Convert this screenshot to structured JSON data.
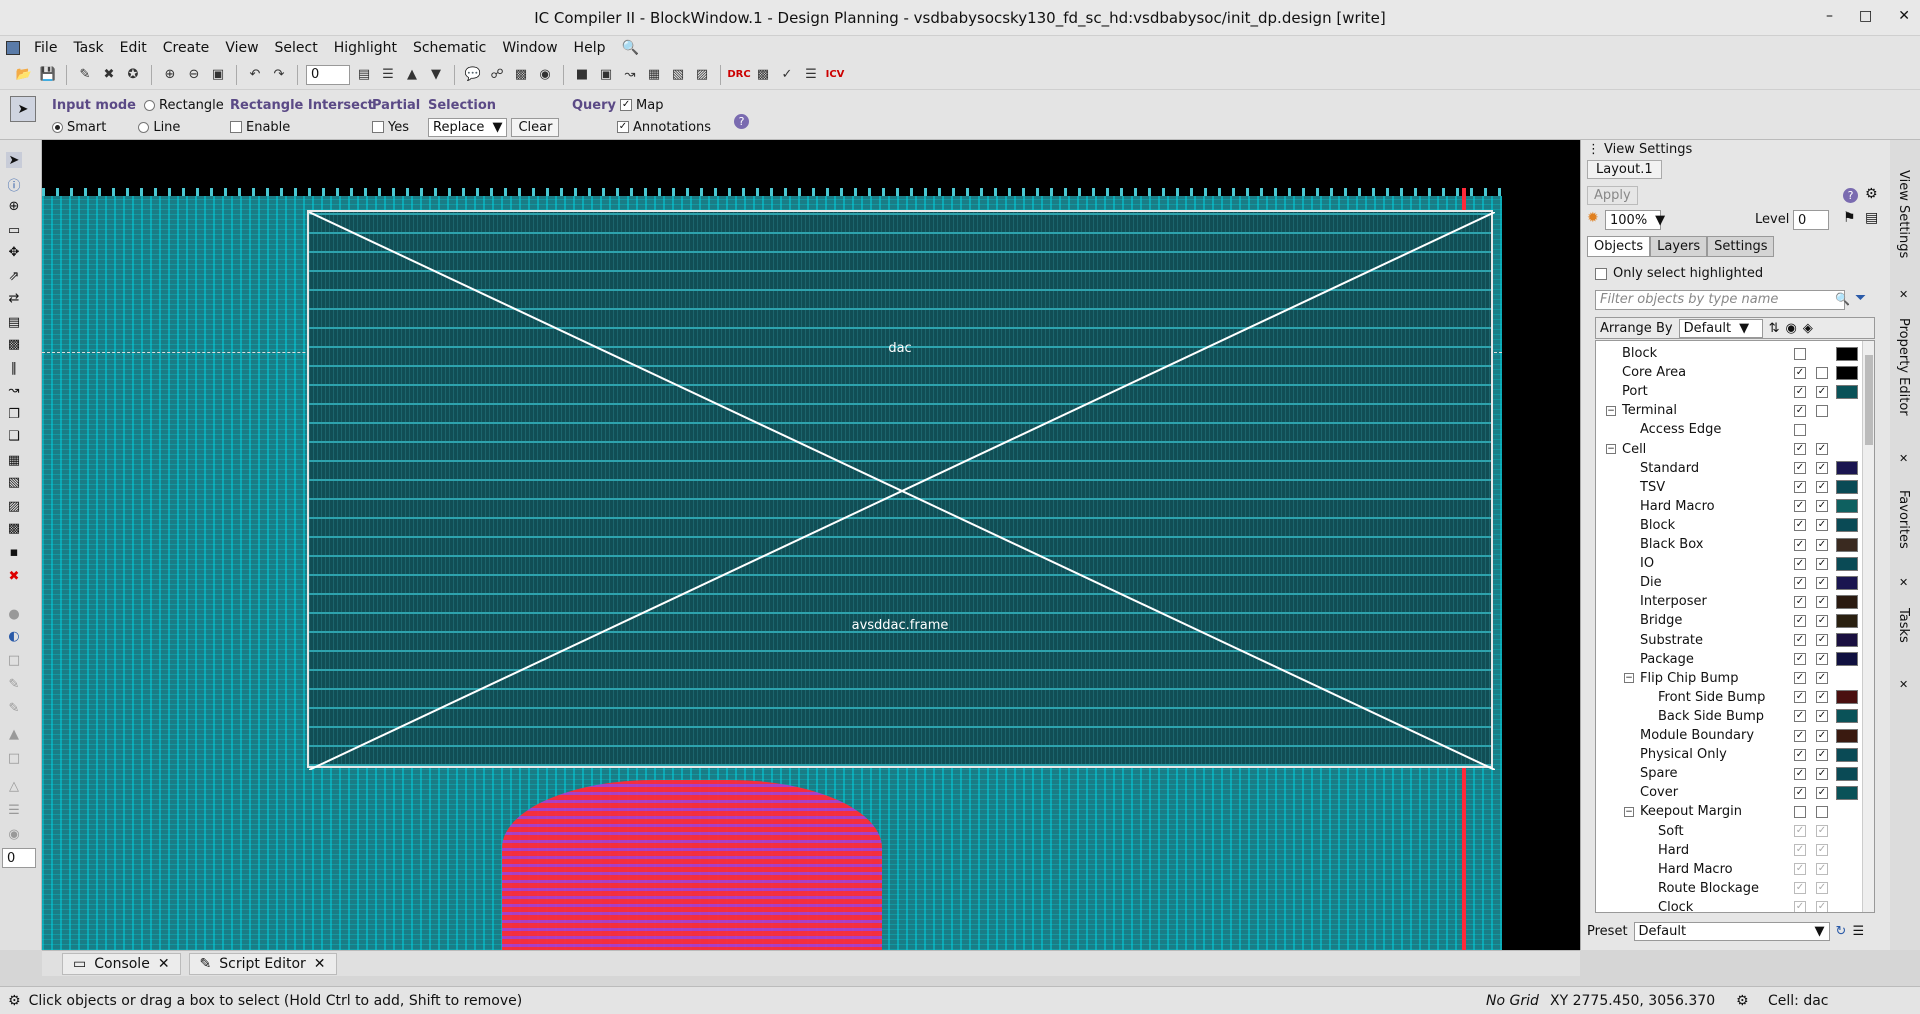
{
  "window": {
    "title": "IC Compiler II - BlockWindow.1 - Design Planning - vsdbabysocsky130_fd_sc_hd:vsdbabysoc/init_dp.design [write]"
  },
  "menu": [
    "File",
    "Task",
    "Edit",
    "Create",
    "View",
    "Select",
    "Highlight",
    "Schematic",
    "Window",
    "Help"
  ],
  "toolbar": {
    "level_value": "0"
  },
  "options": {
    "input_mode": {
      "label": "Input mode",
      "opt1": "Rectangle",
      "opt2": "Smart",
      "opt3": "Line",
      "selected": "Smart"
    },
    "rect_intersect": {
      "label": "Rectangle Intersect",
      "enable": "Enable"
    },
    "partial": {
      "label": "Partial",
      "yes": "Yes"
    },
    "selection": {
      "label": "Selection",
      "value": "Replace",
      "clear": "Clear"
    },
    "query": {
      "label": "Query",
      "map": "Map",
      "annotations": "Annotations"
    }
  },
  "canvas": {
    "cell_label": "dac",
    "frame_label": "avsddac.frame",
    "left_zoom_value": "0"
  },
  "bottom_tabs": {
    "console": "Console",
    "script_editor": "Script Editor"
  },
  "status": {
    "hint": "Click objects or drag a box to select (Hold Ctrl to add, Shift to remove)",
    "grid": "No Grid",
    "xy": "XY 2775.450, 3056.370",
    "cell": "Cell: dac"
  },
  "view_settings": {
    "title": "View Settings",
    "layout_tab": "Layout.1",
    "apply": "Apply",
    "zoom": "100%",
    "level_label": "Level",
    "level_value": "0",
    "tabs": [
      "Objects",
      "Layers",
      "Settings"
    ],
    "only_select_highlighted": "Only select highlighted",
    "filter_placeholder": "Filter objects by type name",
    "arrange_by": "Arrange By",
    "arrange_value": "Default",
    "preset_label": "Preset",
    "preset_value": "Default",
    "objects": [
      {
        "name": "Block",
        "indent": 0,
        "exp": "",
        "c1": "off",
        "c2": "",
        "color": "#000000"
      },
      {
        "name": "Core Area",
        "indent": 0,
        "exp": "",
        "c1": "on",
        "c2": "off",
        "color": "#000000"
      },
      {
        "name": "Port",
        "indent": 0,
        "exp": "",
        "c1": "on",
        "c2": "on",
        "color": "#0a5258"
      },
      {
        "name": "Terminal",
        "indent": 0,
        "exp": "-",
        "c1": "on",
        "c2": "off",
        "color": ""
      },
      {
        "name": "Access Edge",
        "indent": 1,
        "exp": "",
        "c1": "off",
        "c2": "",
        "color": ""
      },
      {
        "name": "Cell",
        "indent": 0,
        "exp": "-",
        "c1": "on",
        "c2": "on",
        "color": ""
      },
      {
        "name": "Standard",
        "indent": 1,
        "exp": "",
        "c1": "on",
        "c2": "on",
        "color": "#1a1550"
      },
      {
        "name": "TSV",
        "indent": 1,
        "exp": "",
        "c1": "on",
        "c2": "on",
        "color": "#0a4a55"
      },
      {
        "name": "Hard Macro",
        "indent": 1,
        "exp": "",
        "c1": "on",
        "c2": "on",
        "color": "#0e6060"
      },
      {
        "name": "Block",
        "indent": 1,
        "exp": "",
        "c1": "on",
        "c2": "on",
        "color": "#0a4a55"
      },
      {
        "name": "Black Box",
        "indent": 1,
        "exp": "",
        "c1": "on",
        "c2": "on",
        "color": "#3a2a20"
      },
      {
        "name": "IO",
        "indent": 1,
        "exp": "",
        "c1": "on",
        "c2": "on",
        "color": "#0a4a55"
      },
      {
        "name": "Die",
        "indent": 1,
        "exp": "",
        "c1": "on",
        "c2": "on",
        "color": "#1a1550"
      },
      {
        "name": "Interposer",
        "indent": 1,
        "exp": "",
        "c1": "on",
        "c2": "on",
        "color": "#2a1a10"
      },
      {
        "name": "Bridge",
        "indent": 1,
        "exp": "",
        "c1": "on",
        "c2": "on",
        "color": "#2a2010"
      },
      {
        "name": "Substrate",
        "indent": 1,
        "exp": "",
        "c1": "on",
        "c2": "on",
        "color": "#1a1040"
      },
      {
        "name": "Package",
        "indent": 1,
        "exp": "",
        "c1": "on",
        "c2": "on",
        "color": "#101040"
      },
      {
        "name": "Flip Chip Bump",
        "indent": 1,
        "exp": "-",
        "c1": "on",
        "c2": "on",
        "color": ""
      },
      {
        "name": "Front Side Bump",
        "indent": 2,
        "exp": "",
        "c1": "on",
        "c2": "on",
        "color": "#4a1010"
      },
      {
        "name": "Back Side Bump",
        "indent": 2,
        "exp": "",
        "c1": "on",
        "c2": "on",
        "color": "#0a5258"
      },
      {
        "name": "Module Boundary",
        "indent": 1,
        "exp": "",
        "c1": "on",
        "c2": "on",
        "color": "#3a1a10"
      },
      {
        "name": "Physical Only",
        "indent": 1,
        "exp": "",
        "c1": "on",
        "c2": "on",
        "color": "#0a4a55"
      },
      {
        "name": "Spare",
        "indent": 1,
        "exp": "",
        "c1": "on",
        "c2": "on",
        "color": "#0a4a55"
      },
      {
        "name": "Cover",
        "indent": 1,
        "exp": "",
        "c1": "on",
        "c2": "on",
        "color": "#0a5258"
      },
      {
        "name": "Keepout Margin",
        "indent": 1,
        "exp": "-",
        "c1": "off",
        "c2": "off",
        "color": ""
      },
      {
        "name": "Soft",
        "indent": 2,
        "exp": "",
        "c1": "dim",
        "c2": "dim",
        "color": ""
      },
      {
        "name": "Hard",
        "indent": 2,
        "exp": "",
        "c1": "dim",
        "c2": "dim",
        "color": ""
      },
      {
        "name": "Hard Macro",
        "indent": 2,
        "exp": "",
        "c1": "dim",
        "c2": "dim",
        "color": ""
      },
      {
        "name": "Route Blockage",
        "indent": 2,
        "exp": "",
        "c1": "dim",
        "c2": "dim",
        "color": ""
      },
      {
        "name": "Clock",
        "indent": 2,
        "exp": "",
        "c1": "dim",
        "c2": "dim",
        "color": ""
      }
    ]
  },
  "side_tabs": [
    "View Settings",
    "Property Editor",
    "Favorites",
    "Tasks"
  ]
}
